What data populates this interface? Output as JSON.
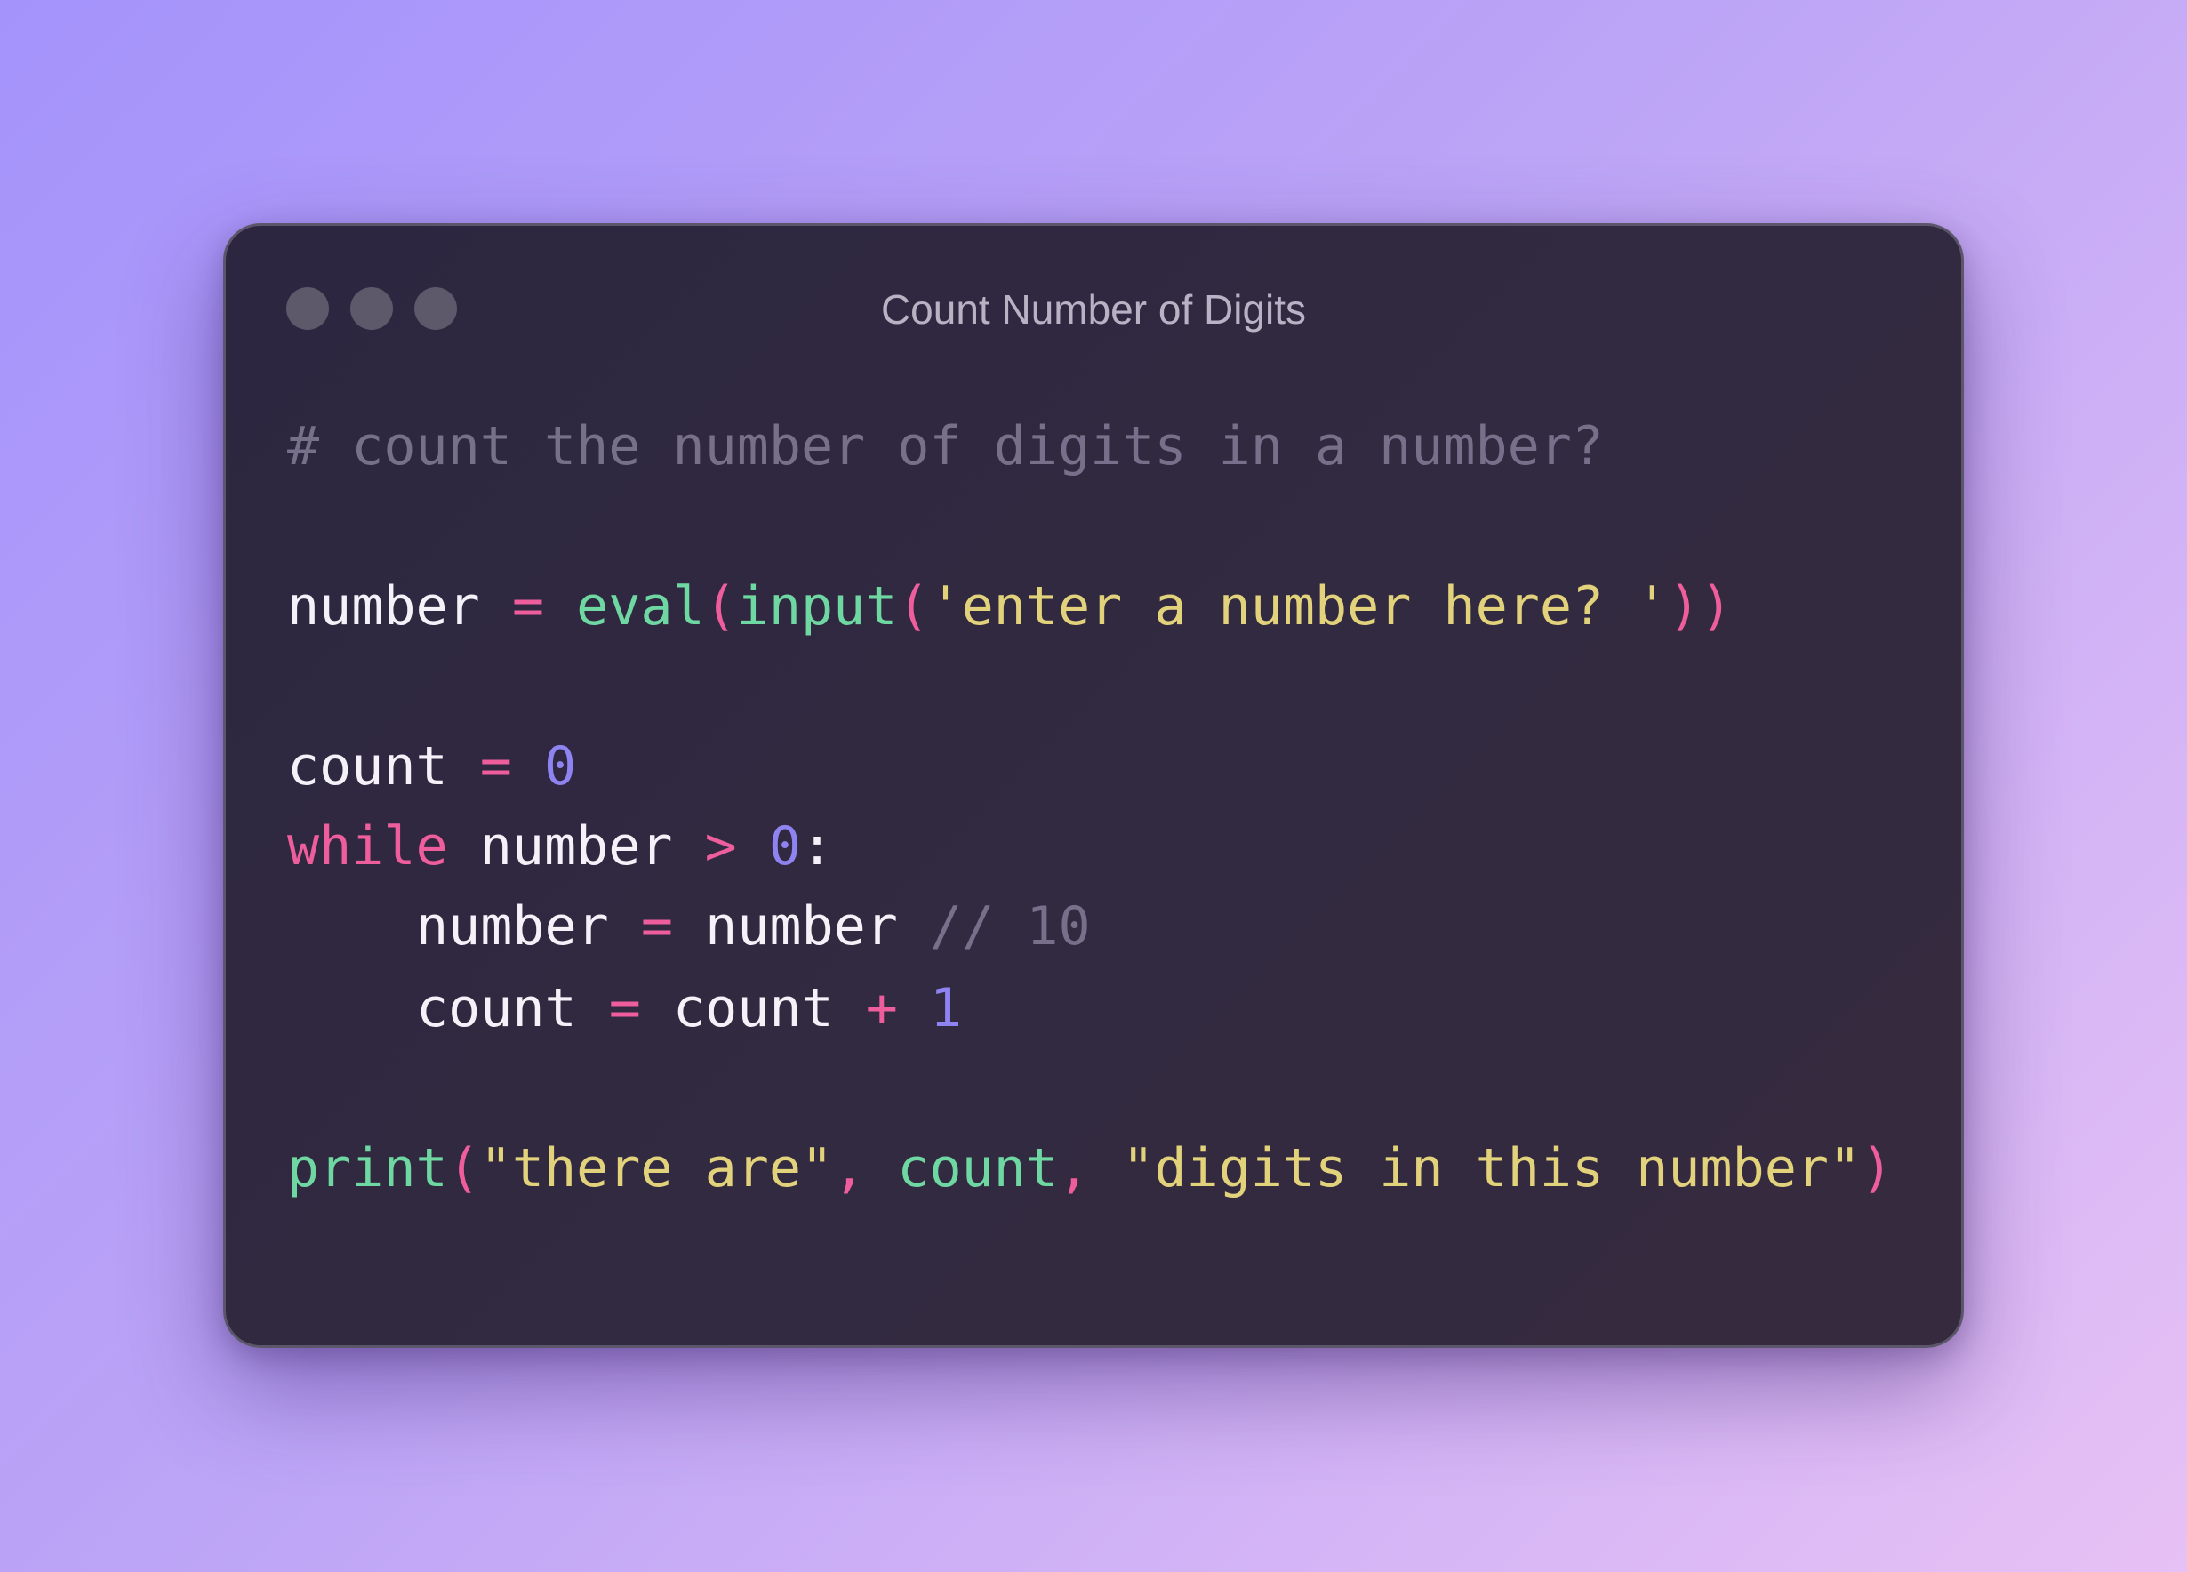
{
  "window": {
    "title": "Count Number of Digits"
  },
  "code": {
    "comment": "# count the number of digits in a number?",
    "line2": {
      "var": "number",
      "eq": "=",
      "fn_eval": "eval",
      "paren_open1": "(",
      "fn_input": "input",
      "paren_open2": "(",
      "string": "'enter a number here? '",
      "paren_close": "))"
    },
    "line3": {
      "var": "count",
      "eq": "=",
      "num": "0"
    },
    "line4": {
      "keyword": "while",
      "var": "number",
      "op": ">",
      "num": "0",
      "colon": ":"
    },
    "line5": {
      "var": "number",
      "eq": "=",
      "var2": "number",
      "comment": "// 10"
    },
    "line6": {
      "var": "count",
      "eq": "=",
      "var2": "count",
      "op": "+",
      "num": "1"
    },
    "line7": {
      "fn_print": "print",
      "paren_open": "(",
      "string1": "\"there are\"",
      "comma1": ",",
      "arg": "count",
      "comma2": ",",
      "string2": "\"digits in this number\"",
      "paren_close": ")"
    }
  },
  "colors": {
    "background_start": "#a493fb",
    "background_end": "#e7c1f5",
    "window": "#2f283f",
    "comment": "#76708a",
    "operator": "#ee5d9c",
    "function": "#6fd8a2",
    "string": "#e3d27c",
    "number": "#8e83f0",
    "text": "#f4f2f8"
  }
}
